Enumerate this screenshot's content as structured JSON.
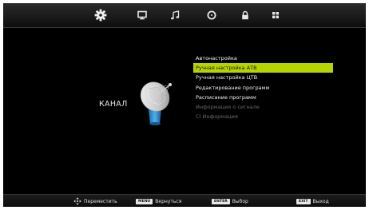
{
  "topbar": {
    "tabs": [
      {
        "icon": "gear-icon",
        "active": true
      },
      {
        "icon": "monitor-icon",
        "active": false
      },
      {
        "icon": "music-note-icon",
        "active": false
      },
      {
        "icon": "clock-icon",
        "active": false
      },
      {
        "icon": "lock-icon",
        "active": false
      },
      {
        "icon": "grid-icon",
        "active": false
      }
    ]
  },
  "main": {
    "title": "КАНАЛ",
    "illustration_icon": "satellite-dish-icon",
    "menu": [
      {
        "label": "Автонастройка",
        "state": "normal"
      },
      {
        "label": "Ручная настройка АТВ",
        "state": "selected"
      },
      {
        "label": "Ручная настройка ЦТВ",
        "state": "normal"
      },
      {
        "label": "Редактирование программ",
        "state": "normal"
      },
      {
        "label": "Расписание программ",
        "state": "normal"
      },
      {
        "label": "Информация о сигнале",
        "state": "disabled"
      },
      {
        "label": "CI Информация",
        "state": "disabled"
      }
    ]
  },
  "bottombar": {
    "move_label": "Переместить",
    "menu_key": "MENU",
    "menu_label": "Вернуться",
    "enter_key": "ENTER",
    "enter_label": "Выбор",
    "exit_key": "EXIT",
    "exit_label": "Выход"
  },
  "colors": {
    "selected": "#b8d400",
    "text": "#f2f2f2",
    "disabled": "#6a6a6a",
    "background": "#000000"
  }
}
